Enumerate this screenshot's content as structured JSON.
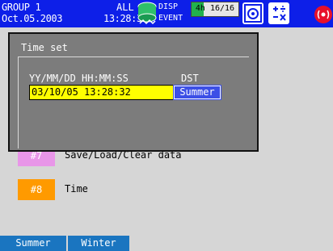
{
  "status_bar": {
    "group": "GROUP 1",
    "scope": "ALL",
    "date": "Oct.05.2003",
    "time": "13:28:36",
    "disp_label": "DISP",
    "event_label": "EVENT",
    "rate_text": "4h 16/16",
    "rate_fill_fraction": 0.25,
    "icons": [
      "drum-icon",
      "memory-icon",
      "calc-icon",
      "alarm-icon"
    ]
  },
  "dialog": {
    "title": "Time set",
    "datetime_header": "YY/MM/DD HH:MM:SS",
    "dst_header": "DST",
    "datetime_value": "03/10/05 13:28:32",
    "dst_value": "Summer"
  },
  "menu": {
    "items": [
      {
        "number": "#7",
        "label": "Save/Load/Clear data",
        "color": "#e896e8"
      },
      {
        "number": "#8",
        "label": "Time",
        "color": "#ff9a00"
      }
    ]
  },
  "softkeys": [
    {
      "label": "Summer"
    },
    {
      "label": "Winter"
    }
  ],
  "colors": {
    "statusbar_bg": "#0d1fe8",
    "dialog_bg": "#7c7c7c",
    "selected_field": "#ffff00",
    "dst_field": "#3c4fe6",
    "softkey_bg": "#1a75c0"
  }
}
